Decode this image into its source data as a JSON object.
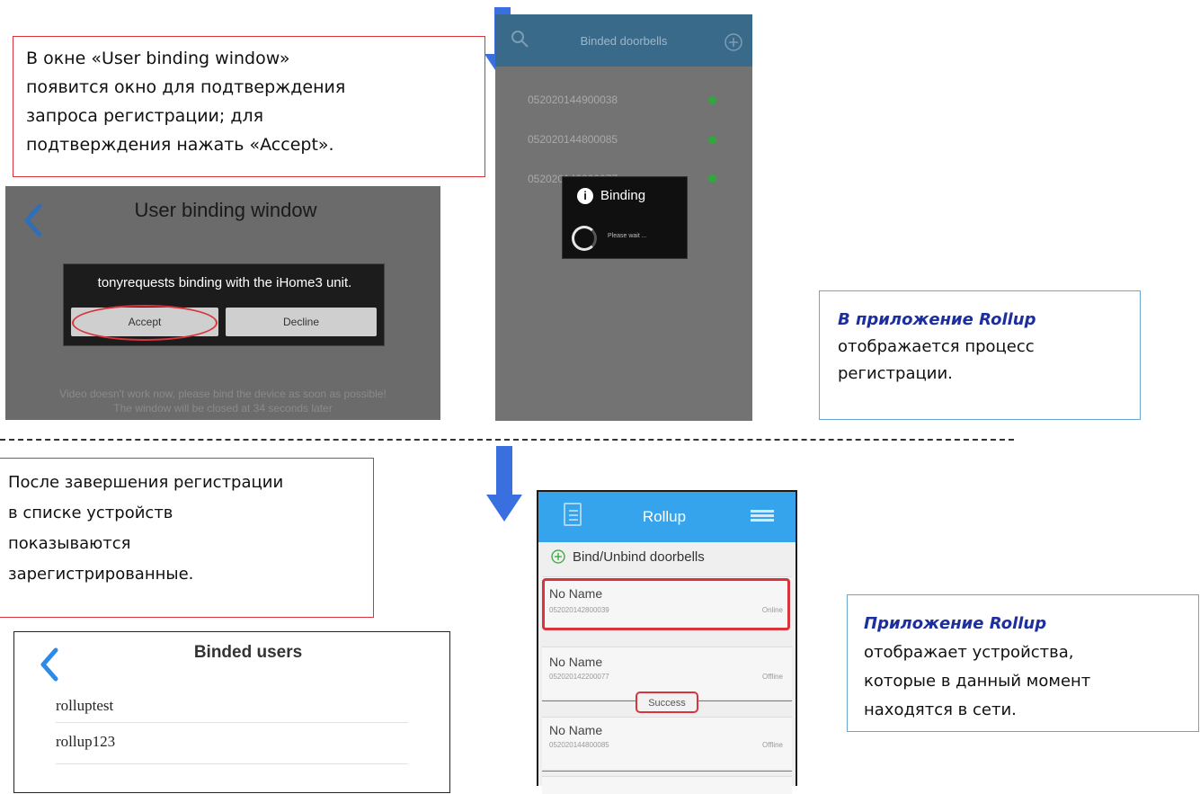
{
  "callouts": {
    "top_left": {
      "lines": [
        "В окне «User binding window»",
        "появится окно для подтверждения",
        "запроса  регистрации; для",
        "подтверждения нажать «Accept»."
      ]
    },
    "top_right": {
      "title": "В приложение Rollup",
      "lines": [
        "отображается процесс",
        "регистрации."
      ]
    },
    "bottom_left": {
      "lines": [
        "После завершения регистрации",
        "в списке устройств",
        "показываются",
        "зарегистрированные."
      ]
    },
    "bottom_right": {
      "title": "Приложение Rollup",
      "lines": [
        "отображает устройства,",
        "которые в данный момент",
        "находятся в сети."
      ]
    }
  },
  "user_binding_window": {
    "title": "User binding window",
    "dialog_message": "tonyrequests binding with the iHome3 unit.",
    "accept_label": "Accept",
    "decline_label": "Decline",
    "footer_line1": "Video doesn't work now, please bind the device as soon as possible!",
    "footer_line2": "The window will be closed at 34 seconds later"
  },
  "binded_doorbells": {
    "title": "Binded doorbells",
    "rows": [
      "052020144900038",
      "052020144800085",
      "052020142800077"
    ],
    "binding_title": "Binding",
    "binding_wait": "Please wait ..."
  },
  "binded_users": {
    "title": "Binded users",
    "users": [
      "rolluptest",
      "rollup123"
    ]
  },
  "rollup": {
    "title": "Rollup",
    "bind_label": "Bind/Unbind doorbells",
    "toast": "Success",
    "devices": [
      {
        "name": "No Name",
        "id": "052020142800039",
        "status": "Online"
      },
      {
        "name": "No Name",
        "id": "052020142200077",
        "status": "Offline"
      },
      {
        "name": "No Name",
        "id": "052020144800085",
        "status": "Offline"
      }
    ]
  },
  "colors": {
    "accent_red": "#d8343c",
    "accent_blue": "#3a6fe0",
    "rollup_header": "#36a4ec",
    "status_green": "#31a83b"
  }
}
